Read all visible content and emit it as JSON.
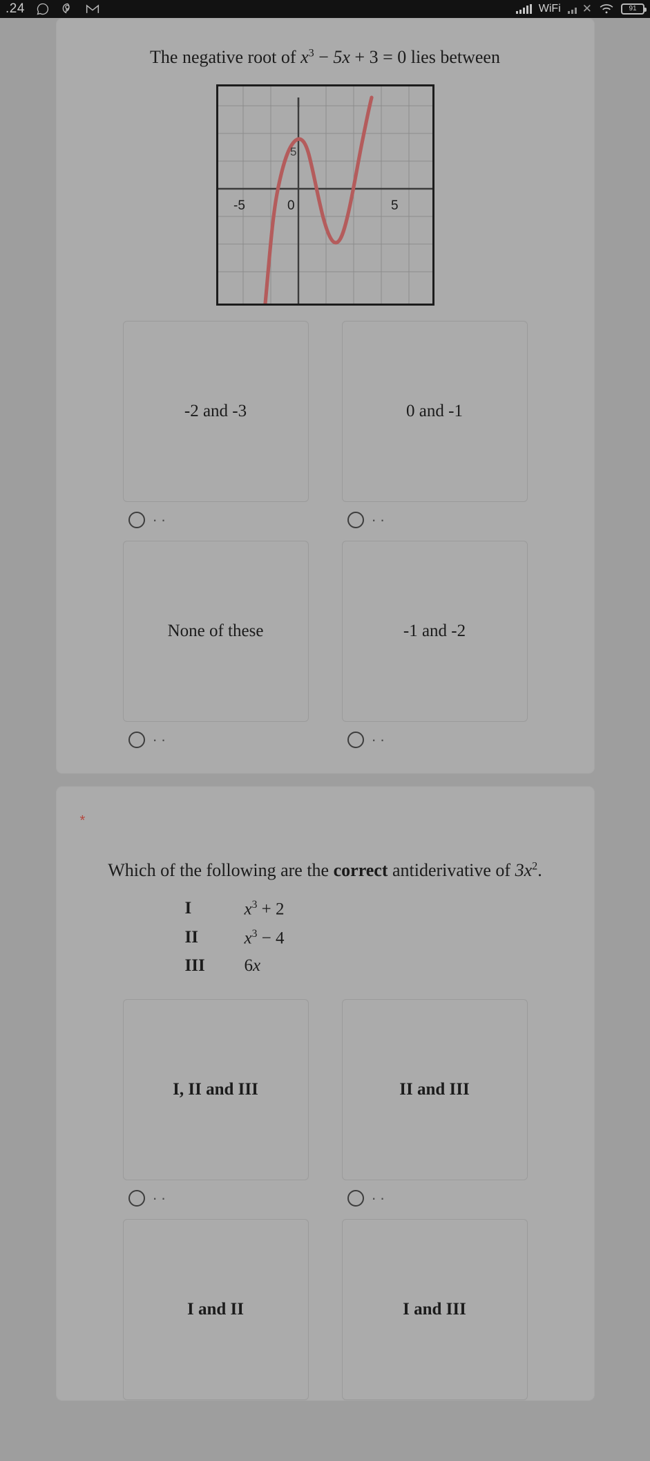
{
  "statusbar": {
    "time": ".24",
    "left_icons": [
      "whatsapp-icon",
      "pinterest-icon",
      "gmail-icon"
    ],
    "wifi_label": "WiFi",
    "signal_icon": "signal-bars-icon",
    "signal_off_icon": "signal-x-icon",
    "wifi_icon": "wifi-icon",
    "battery_level": "91"
  },
  "questions": [
    {
      "id": "q1",
      "required_marker": "",
      "prompt_prefix": "The negative root of ",
      "prompt_math": "x³ − 5x + 3 = 0",
      "prompt_suffix": " lies between",
      "figure": {
        "name": "cubic-graph",
        "curve_color": "#b45c5c",
        "axis_color": "#4a4a4a",
        "grid_color": "#8d8d8d",
        "x_ticks": [
          "-5",
          "0",
          "5"
        ],
        "y_ticks": [
          "5"
        ]
      },
      "options": [
        {
          "label": "-2 and -3",
          "selected": false
        },
        {
          "label": "0 and -1",
          "selected": false
        },
        {
          "label": "None of these",
          "selected": false
        },
        {
          "label": "-1 and -2",
          "selected": false
        }
      ]
    },
    {
      "id": "q2",
      "required_marker": "*",
      "prompt_prefix": "Which  of the following are the ",
      "prompt_bold": "correct",
      "prompt_mid": " antiderivative of ",
      "prompt_math": "3x²",
      "prompt_suffix": ".",
      "roman_items": [
        {
          "key": "I",
          "value": "x³ + 2"
        },
        {
          "key": "II",
          "value": "x³ − 4"
        },
        {
          "key": "III",
          "value": "6x"
        }
      ],
      "options": [
        {
          "label": "I, II and III",
          "selected": false
        },
        {
          "label": "II and III",
          "selected": false
        },
        {
          "label": "I and II",
          "selected": false
        },
        {
          "label": "I and III",
          "selected": false
        }
      ]
    }
  ],
  "chart_data": {
    "type": "line",
    "title": "",
    "xlabel": "",
    "ylabel": "",
    "xlim": [
      -7,
      7
    ],
    "ylim": [
      -7,
      9
    ],
    "x_tick_labels": [
      "-5",
      "0",
      "5"
    ],
    "x_tick_values": [
      -5,
      0,
      5
    ],
    "y_tick_labels": [
      "5"
    ],
    "y_tick_values": [
      5
    ],
    "grid": true,
    "legend": "none",
    "series": [
      {
        "name": "y = x^3 - 5x + 3",
        "expression": "x^3 - 5x + 3",
        "color": "#b45c5c",
        "x": [
          -3.2,
          -3.0,
          -2.8,
          -2.6,
          -2.4,
          -2.2,
          -2.0,
          -1.8,
          -1.6,
          -1.4,
          -1.2,
          -1.0,
          -0.8,
          -0.6,
          -0.4,
          -0.2,
          0.0,
          0.2,
          0.4,
          0.6,
          0.8,
          1.0,
          1.2,
          1.4,
          1.6,
          1.8,
          2.0,
          2.2,
          2.4,
          2.6
        ],
        "y": [
          -13.8,
          -9.0,
          -4.9,
          -1.6,
          1.2,
          3.3,
          5.0,
          6.2,
          6.9,
          7.3,
          7.3,
          7.0,
          6.5,
          5.8,
          4.9,
          4.0,
          3.0,
          2.0,
          1.1,
          0.2,
          -0.5,
          -1.0,
          -1.3,
          -1.3,
          -0.9,
          -0.2,
          1.0,
          2.6,
          4.8,
          7.6
        ]
      }
    ]
  }
}
